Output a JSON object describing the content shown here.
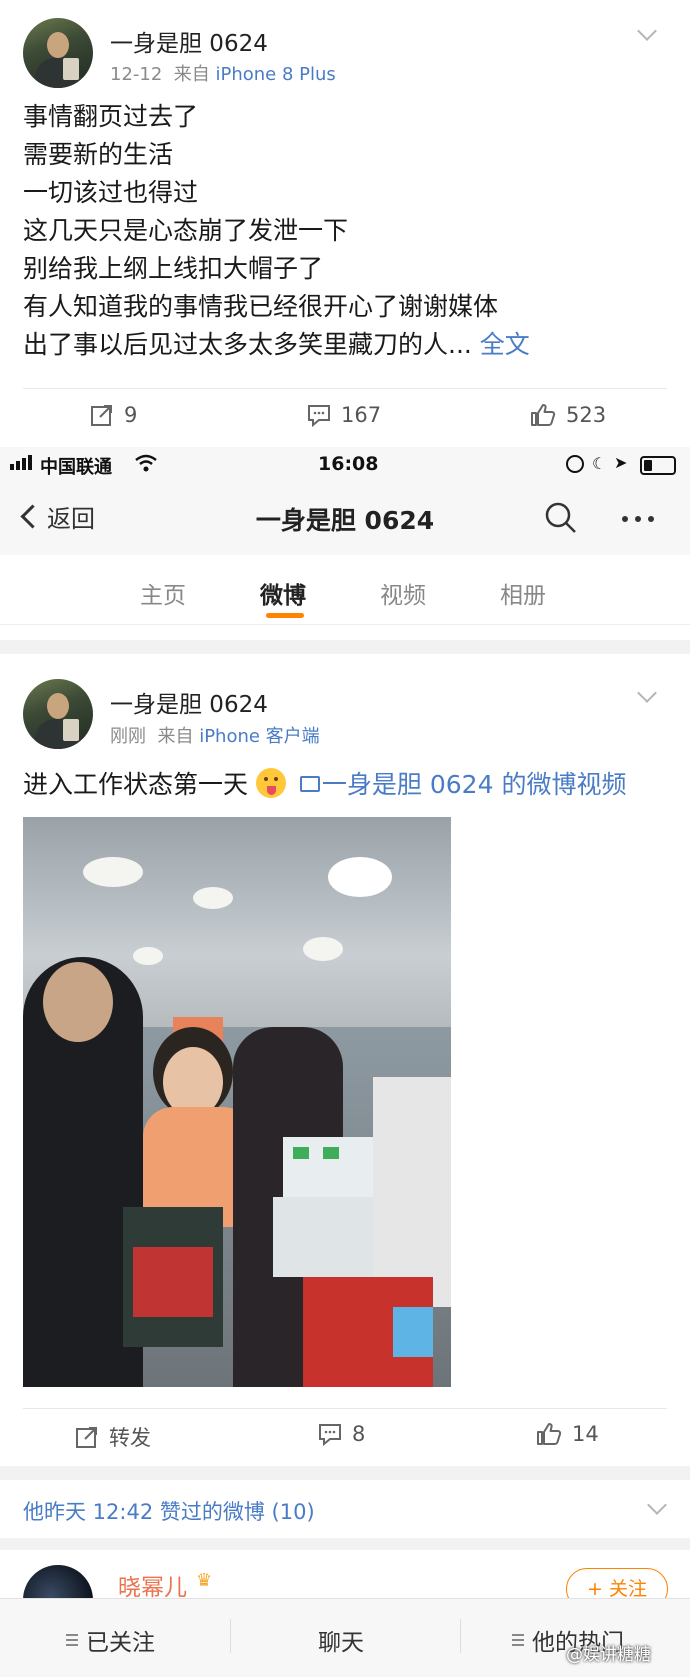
{
  "post1": {
    "author": "一身是胆 0624",
    "date": "12-12",
    "source_prefix": "来自",
    "source": "iPhone 8 Plus",
    "lines": [
      "事情翻页过去了",
      "需要新的生活",
      "一切该过也得过",
      "这几天只是心态崩了发泄一下",
      "别给我上纲上线扣大帽子了",
      "有人知道我的事情我已经很开心了谢谢媒体",
      "出了事以后见过太多太多笑里藏刀的人..."
    ],
    "full_text_link": "全文",
    "repost_count": "9",
    "comment_count": "167",
    "like_count": "523"
  },
  "status_bar": {
    "carrier": "中国联通",
    "time": "16:08"
  },
  "nav": {
    "back_label": "返回",
    "title": "一身是胆 0624"
  },
  "tabs": [
    "主页",
    "微博",
    "视频",
    "相册"
  ],
  "post2": {
    "author": "一身是胆 0624",
    "date": "刚刚",
    "source_prefix": "来自",
    "source": "iPhone 客户端",
    "text": "进入工作状态第一天",
    "emoji": "😛",
    "video_link": "一身是胆 0624 的微博视频",
    "repost_label": "转发",
    "comment_count": "8",
    "like_count": "14"
  },
  "liked_section": {
    "title": "他昨天 12:42 赞过的微博 (10)"
  },
  "suggested": {
    "name": "晓幂儿",
    "follow_label": "+ 关注"
  },
  "bottom_bar": {
    "followed": "已关注",
    "chat": "聊天",
    "hot": "他的热门"
  },
  "watermark": "@娱讲糖糖",
  "colors": {
    "accent": "#ff8200",
    "link": "#4a7cc6",
    "name_orange": "#eb7350"
  }
}
